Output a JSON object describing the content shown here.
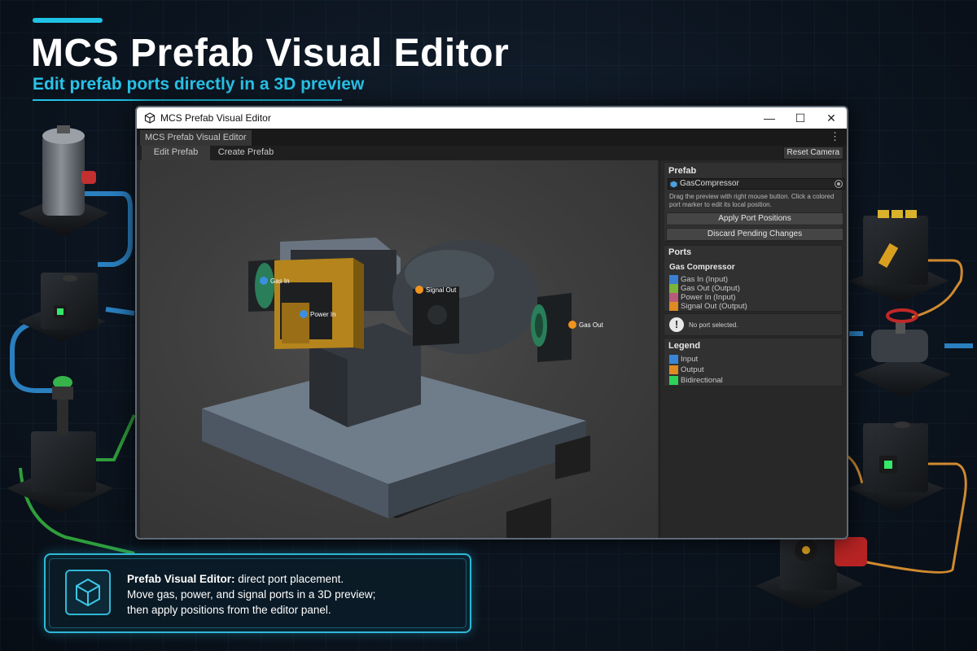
{
  "hero": {
    "title": "MCS Prefab Visual Editor",
    "subtitle": "Edit prefab ports directly in a 3D preview"
  },
  "window": {
    "title": "MCS Prefab Visual Editor",
    "controls": {
      "minimize": "—",
      "maximize": "☐",
      "close": "✕"
    },
    "tab_label": "MCS Prefab Visual Editor",
    "menu_glyph": "⋮",
    "mode_tabs": [
      "Edit Prefab",
      "Create Prefab"
    ],
    "active_tab": "Edit Prefab",
    "reset_camera": "Reset Camera"
  },
  "viewport": {
    "ports": [
      {
        "label": "Gas In",
        "kind": "input",
        "color": "#3a8fe0"
      },
      {
        "label": "Power In",
        "kind": "input",
        "color": "#3a8fe0"
      },
      {
        "label": "Signal Out",
        "kind": "output",
        "color": "#f0941e"
      },
      {
        "label": "Gas Out",
        "kind": "output",
        "color": "#f0941e"
      }
    ]
  },
  "inspector": {
    "prefab_title": "Prefab",
    "prefab_value": "GasCompressor",
    "hint": "Drag the preview with right mouse button. Click a colored port marker to edit its local position.",
    "apply_button": "Apply Port Positions",
    "discard_button": "Discard Pending Changes",
    "ports_title": "Ports",
    "group_name": "Gas Compressor",
    "port_list": [
      {
        "label": "Gas In (Input)",
        "color": "#3a7fd0"
      },
      {
        "label": "Gas Out (Output)",
        "color": "#7cb33a"
      },
      {
        "label": "Power In (Input)",
        "color": "#b85a7a"
      },
      {
        "label": "Signal Out (Output)",
        "color": "#e08a22"
      }
    ],
    "no_selection": "No port selected.",
    "info_glyph": "!",
    "legend_title": "Legend",
    "legend": [
      {
        "label": "Input",
        "color": "#3a86d6"
      },
      {
        "label": "Output",
        "color": "#e08a22"
      },
      {
        "label": "Bidirectional",
        "color": "#2ed15a"
      }
    ]
  },
  "callout": {
    "heading": "Prefab Visual Editor:",
    "heading_rest": " direct port placement.",
    "line2": "Move gas, power, and signal ports in a 3D preview;",
    "line3": "then apply positions from the editor panel."
  },
  "colors": {
    "accent": "#1fc3e6",
    "input_port": "#3a8fe0",
    "output_port": "#f0941e"
  }
}
